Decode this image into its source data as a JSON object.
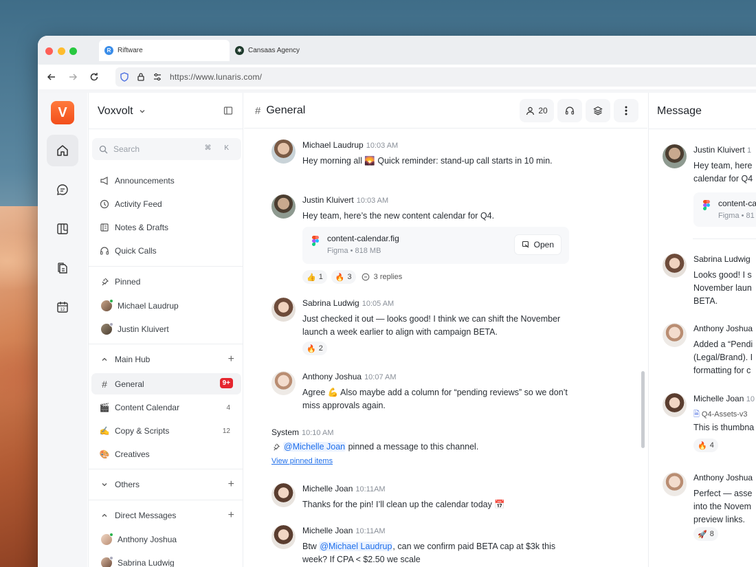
{
  "browser": {
    "tabs": [
      {
        "label": "Riftware",
        "favicon": "R"
      },
      {
        "label": "Cansaas Agency",
        "favicon": "C"
      }
    ],
    "url": "https://www.lunaris.com/"
  },
  "rail": {
    "logo": "V",
    "items": [
      "home-icon",
      "chat-icon",
      "board-icon",
      "documents-icon",
      "calendar-icon"
    ]
  },
  "sidebar": {
    "workspace": "Voxvolt",
    "search": {
      "placeholder": "Search",
      "shortcut": "⌘ K"
    },
    "nav": [
      "Announcements",
      "Activity Feed",
      "Notes & Drafts",
      "Quick Calls"
    ],
    "pinned": {
      "label": "Pinned",
      "people": [
        "Michael Laudrup",
        "Justin Kluivert"
      ]
    },
    "main_hub": {
      "label": "Main Hub",
      "channels": [
        {
          "name": "General",
          "badge": "9+"
        },
        {
          "name": "Content Calendar",
          "count": "4"
        },
        {
          "name": "Copy & Scripts",
          "count": "12"
        },
        {
          "name": "Creatives"
        }
      ]
    },
    "others": {
      "label": "Others"
    },
    "dms": {
      "label": "Direct Messages",
      "people": [
        "Anthony Joshua",
        "Sabrina Ludwig"
      ]
    }
  },
  "chat": {
    "channel": "General",
    "members": "20",
    "messages": [
      {
        "author": "Michael Laudrup",
        "time": "10:03 AM",
        "text": "Hey morning all 🌄 Quick reminder: stand-up call starts in 10 min."
      },
      {
        "author": "Justin Kluivert",
        "time": "10:03 AM",
        "text": "Hey team, here’s the new content calendar for Q4.",
        "file": {
          "name": "content-calendar.fig",
          "meta": "Figma • 818 MB",
          "action": "Open"
        },
        "reactions": [
          {
            "emoji": "👍",
            "count": "1"
          },
          {
            "emoji": "🔥",
            "count": "3"
          }
        ],
        "replies": "3 replies"
      },
      {
        "author": "Sabrina Ludwig",
        "time": "10:05 AM",
        "text": "Just checked it out — looks good! I think we can shift the November launch a week earlier to align with campaign BETA.",
        "reactions": [
          {
            "emoji": "🔥",
            "count": "2"
          }
        ]
      },
      {
        "author": "Anthony Joshua",
        "time": "10:07 AM",
        "text": "Agree 💪 Also maybe add a column for “pending reviews” so we don’t miss approvals again."
      },
      {
        "author": "System",
        "time": "10:10 AM",
        "mention": "@Michelle Joan",
        "text": " pinned a message to this channel.",
        "link": "View pinned items"
      },
      {
        "author": "Michelle Joan",
        "time": "10:11AM",
        "text": "Thanks for the pin! I’ll clean up the calendar today 📅"
      },
      {
        "author": "Michelle Joan",
        "time": "10:11AM",
        "text_before": "Btw ",
        "mention": "@Michael Laudrup",
        "text": ", can we confirm paid BETA cap at $3k this week? If CPA < $2.50 we scale"
      }
    ]
  },
  "panel": {
    "title": "Message",
    "messages": [
      {
        "author": "Justin Kluivert",
        "time": "1",
        "text1": "Hey team, here",
        "text2": "calendar for Q4",
        "file": {
          "name": "content-ca",
          "meta": "Figma • 81"
        }
      },
      {
        "author": "Sabrina Ludwig",
        "text1": "Looks good! I s",
        "text2": "November laun",
        "text3": "BETA."
      },
      {
        "author": "Anthony Joshua",
        "text1": "Added a “Pendi",
        "text2": "(Legal/Brand). I",
        "text3": "formatting for c"
      },
      {
        "author": "Michelle Joan",
        "time": "10",
        "attachment": "Q4-Assets-v3",
        "text1": "This is thumbna",
        "reaction": {
          "emoji": "🔥",
          "count": "4"
        }
      },
      {
        "author": "Anthony Joshua",
        "text1": "Perfect — asse",
        "text2": "into the Novem",
        "text3": "preview links.",
        "reaction": {
          "emoji": "🚀",
          "count": "8"
        }
      }
    ]
  },
  "colors": {
    "accent": "#f24e1b",
    "badge": "#e5262e",
    "mention": "#1f6feb",
    "online": "#2bb24c"
  }
}
